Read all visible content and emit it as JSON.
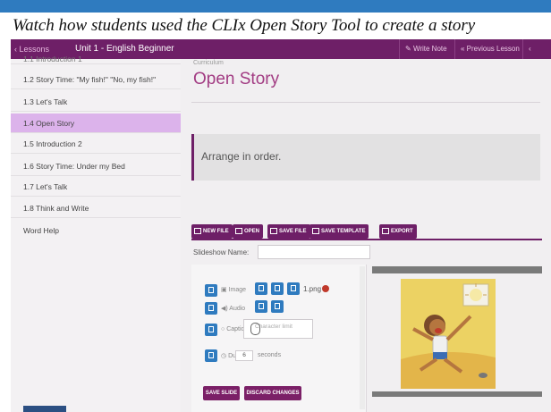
{
  "video_caption": "Watch how students used the CLIx Open Story Tool to create a story",
  "navbar": {
    "lessons_label": "‹ Lessons",
    "unit_title": "Unit 1 - English Beginner",
    "write_note": "Write Note",
    "previous_lesson": "« Previous Lesson",
    "prev": "‹ PREV"
  },
  "sidebar": {
    "items": [
      {
        "label": "1.1 Introduction 1",
        "active": false
      },
      {
        "label": "1.2 Story Time: \"My fish!\" \"No, my fish!\"",
        "active": false
      },
      {
        "label": "1.3 Let's Talk",
        "active": false
      },
      {
        "label": "1.4 Open Story",
        "active": true
      },
      {
        "label": "1.5 Introduction 2",
        "active": false
      },
      {
        "label": "1.6 Story Time: Under my Bed",
        "active": false
      },
      {
        "label": "1.7 Let's Talk",
        "active": false
      },
      {
        "label": "1.8 Think and Write",
        "active": false
      },
      {
        "label": "Word Help",
        "active": false
      }
    ]
  },
  "main": {
    "breadcrumb": "Curriculum",
    "title": "Open Story",
    "instruction": "Arrange in order."
  },
  "toolbar": {
    "new_file": "NEW FILE",
    "open": "OPEN",
    "save_file": "SAVE FILE",
    "save_template": "SAVE TEMPLATE",
    "export": "EXPORT"
  },
  "slideshow": {
    "name_label": "Slideshow Name:",
    "name_value": ""
  },
  "editor": {
    "image_label": "Image",
    "image_filename": "1.png",
    "audio_label": "Audio",
    "caption_label": "Caption",
    "caption_placeholder": "Character limit",
    "duration_label": "Duration",
    "duration_value": "6",
    "duration_unit": "seconds",
    "save_slide": "SAVE SLIDE",
    "discard_changes": "DISCARD CHANGES"
  },
  "colors": {
    "brand_purple": "#6e1f67",
    "active_item": "#dcb3eb",
    "accent_blue": "#2f7bbf",
    "title_magenta": "#a23c83"
  }
}
